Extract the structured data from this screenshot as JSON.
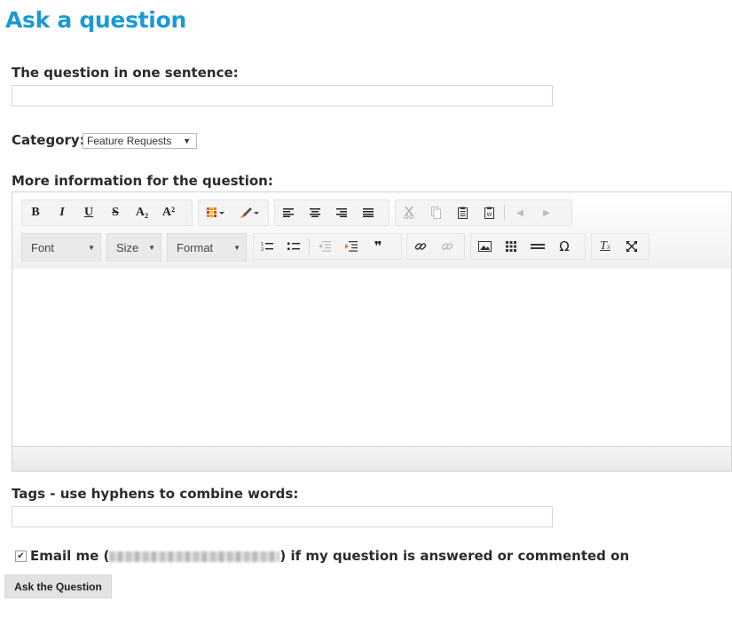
{
  "page": {
    "title": "Ask a question"
  },
  "form": {
    "question_label": "The question in one sentence:",
    "question_value": "",
    "category_label": "Category:",
    "category_selected": "Feature Requests",
    "more_info_label": "More information for the question:",
    "tags_label": "Tags - use hyphens to combine words:",
    "tags_value": "",
    "email_prefix": "Email me (",
    "email_suffix": ") if my question is answered or commented on",
    "email_checked": true,
    "submit_label": "Ask the Question"
  },
  "editor": {
    "text_format": {
      "bold": "B",
      "italic": "I",
      "underline": "U",
      "strike": "S",
      "subscript": "A₂",
      "superscript": "A²"
    },
    "combos": {
      "font": "Font",
      "size": "Size",
      "format": "Format"
    },
    "special_char": "Ω",
    "quote": "❞",
    "remove_format": "Tx",
    "icons": [
      "bold-icon",
      "italic-icon",
      "underline-icon",
      "strikethrough-icon",
      "subscript-icon",
      "superscript-icon",
      "text-color-icon",
      "background-color-icon",
      "align-left-icon",
      "align-center-icon",
      "align-right-icon",
      "justify-icon",
      "cut-icon",
      "copy-icon",
      "paste-icon",
      "paste-word-icon",
      "undo-icon",
      "redo-icon",
      "numbered-list-icon",
      "bulleted-list-icon",
      "outdent-icon",
      "indent-icon",
      "blockquote-icon",
      "link-icon",
      "unlink-icon",
      "image-icon",
      "table-icon",
      "horizontal-line-icon",
      "special-char-icon",
      "remove-format-icon",
      "maximize-icon"
    ]
  },
  "colors": {
    "title": "#1a9ad6",
    "remove_format": "#c0392b"
  }
}
